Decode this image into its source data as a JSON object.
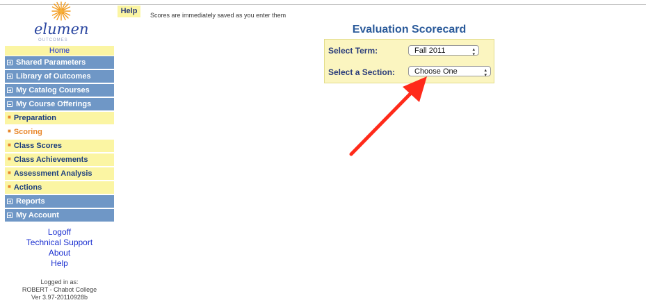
{
  "logo": {
    "text": "elumen",
    "subtitle": "OUTCOMES"
  },
  "header": {
    "help_label": "Help",
    "message": "Scores are immediately saved as you enter them"
  },
  "sidebar": {
    "home": "Home",
    "items": [
      {
        "label": "Shared Parameters",
        "type": "section",
        "expanded": false
      },
      {
        "label": "Library of Outcomes",
        "type": "section",
        "expanded": false
      },
      {
        "label": "My Catalog Courses",
        "type": "section",
        "expanded": false
      },
      {
        "label": "My Course Offerings",
        "type": "section",
        "expanded": true
      },
      {
        "label": "Preparation",
        "type": "sub"
      },
      {
        "label": "Scoring",
        "type": "sub",
        "active": true
      },
      {
        "label": "Class Scores",
        "type": "sub"
      },
      {
        "label": "Class Achievements",
        "type": "sub"
      },
      {
        "label": "Assessment Analysis",
        "type": "sub"
      },
      {
        "label": "Actions",
        "type": "sub"
      },
      {
        "label": "Reports",
        "type": "section",
        "expanded": false
      },
      {
        "label": "My Account",
        "type": "section",
        "expanded": false
      }
    ],
    "links": [
      "Logoff",
      "Technical Support",
      "About",
      "Help"
    ],
    "login": {
      "line1": "Logged in as:",
      "line2": "ROBERT - Chabot College",
      "line3": "Ver 3.97-20110928b"
    }
  },
  "scorecard": {
    "title": "Evaluation Scorecard",
    "term_label": "Select Term:",
    "term_value": "Fall 2011",
    "section_label": "Select a Section:",
    "section_value": "Choose One"
  },
  "colors": {
    "nav_blue": "#6f97c6",
    "nav_yellow": "#fbf5a3",
    "active_orange": "#e8862a",
    "title_blue": "#2a5a9a",
    "arrow_red": "#ff2a1a"
  }
}
